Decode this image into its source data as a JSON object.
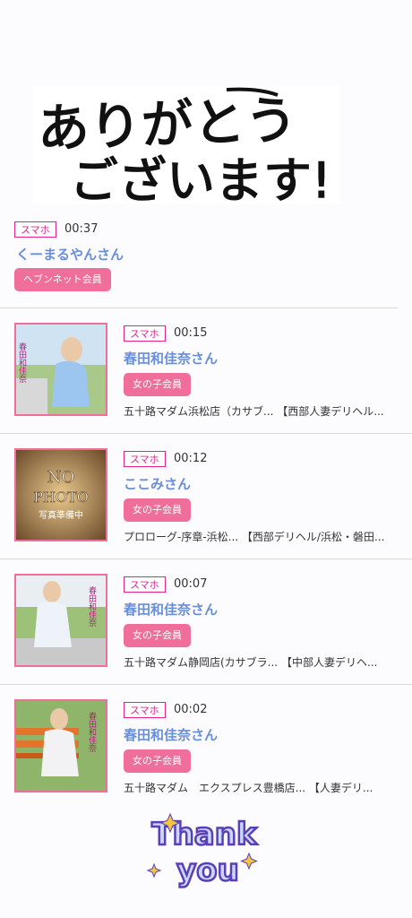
{
  "header": {
    "image_text": "ありがとうございます!"
  },
  "first_entry": {
    "device": "スマホ",
    "time": "00:37",
    "name": "くーまるやんさん",
    "member_type": "ヘブンネット会員"
  },
  "entries": [
    {
      "device": "スマホ",
      "time": "00:15",
      "name": "春田和佳奈さん",
      "member_type": "女の子会員",
      "shop": "五十路マダム浜松店（カサブ... 【西部人妻デリヘル...",
      "photo_caption": "春田和佳奈"
    },
    {
      "device": "スマホ",
      "time": "00:12",
      "name": "ここみさん",
      "member_type": "女の子会員",
      "shop": "プロローグ-序章-浜松... 【西部デリヘル/浜松・磐田...",
      "photo_caption": "NO PHOTO 写真準備中"
    },
    {
      "device": "スマホ",
      "time": "00:07",
      "name": "春田和佳奈さん",
      "member_type": "女の子会員",
      "shop": "五十路マダム静岡店(カサブラ... 【中部人妻デリヘ...",
      "photo_caption": "春田和佳奈"
    },
    {
      "device": "スマホ",
      "time": "00:02",
      "name": "春田和佳奈さん",
      "member_type": "女の子会員",
      "shop": "五十路マダム　エクスプレス豊橋店... 【人妻デリ...",
      "photo_caption": "春田和佳奈"
    }
  ],
  "footer": {
    "image_text": "Thank you"
  },
  "colors": {
    "accent": "#e0248c",
    "button": "#ef6f9a",
    "name": "#6a8fd9"
  }
}
